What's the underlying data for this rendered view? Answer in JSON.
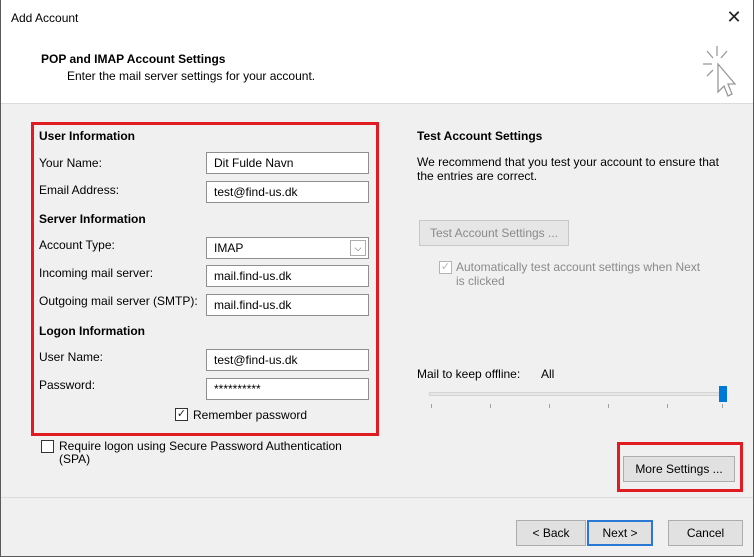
{
  "window": {
    "title": "Add Account",
    "close_glyph": "✕"
  },
  "header": {
    "title": "POP and IMAP Account Settings",
    "subtitle": "Enter the mail server settings for your account.",
    "icon": "wizard-cursor-icon"
  },
  "user_info": {
    "heading": "User Information",
    "your_name_label": "Your Name:",
    "your_name_value": "Dit Fulde Navn",
    "email_label": "Email Address:",
    "email_value": "test@find-us.dk"
  },
  "server_info": {
    "heading": "Server Information",
    "account_type_label": "Account Type:",
    "account_type_value": "IMAP",
    "incoming_label": "Incoming mail server:",
    "incoming_value": "mail.find-us.dk",
    "outgoing_label": "Outgoing mail server (SMTP):",
    "outgoing_value": "mail.find-us.dk"
  },
  "logon_info": {
    "heading": "Logon Information",
    "user_name_label": "User Name:",
    "user_name_value": "test@find-us.dk",
    "password_label": "Password:",
    "password_value": "**********",
    "remember_label": "Remember password",
    "remember_checked": true
  },
  "spa": {
    "label_line1": "Require logon using Secure Password Authentication",
    "label_line2": "(SPA)",
    "checked": false
  },
  "test_settings": {
    "heading": "Test Account Settings",
    "description_line1": "We recommend that you test your account to ensure that",
    "description_line2": "the entries are correct.",
    "button_label": "Test Account Settings ...",
    "auto_test_line1": "Automatically test account settings when Next",
    "auto_test_line2": "is clicked",
    "auto_test_checked": true
  },
  "offline": {
    "label": "Mail to keep offline:",
    "value": "All",
    "slider_level": 1.0
  },
  "more_settings_label": "More Settings ...",
  "footer": {
    "back_label": "< Back",
    "next_label": "Next >",
    "cancel_label": "Cancel"
  },
  "colors": {
    "highlight": "#e11b22",
    "accent": "#0078d7"
  }
}
